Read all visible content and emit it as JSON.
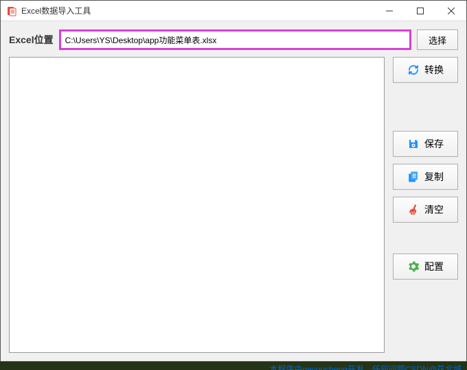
{
  "window": {
    "title": "Excel数据导入工具"
  },
  "path": {
    "label": "Excel位置",
    "value": "C:\\Users\\YS\\Desktop\\app功能菜单表.xlsx",
    "select_button": "选择"
  },
  "buttons": {
    "convert": "转换",
    "save": "保存",
    "copy": "复制",
    "clear": "清空",
    "config": "配置"
  },
  "footer": {
    "text": "本程序由geyoucheng开发，任何问题CSDN@花北城"
  },
  "colors": {
    "highlight": "#d63fd6",
    "link": "#0066cc"
  }
}
